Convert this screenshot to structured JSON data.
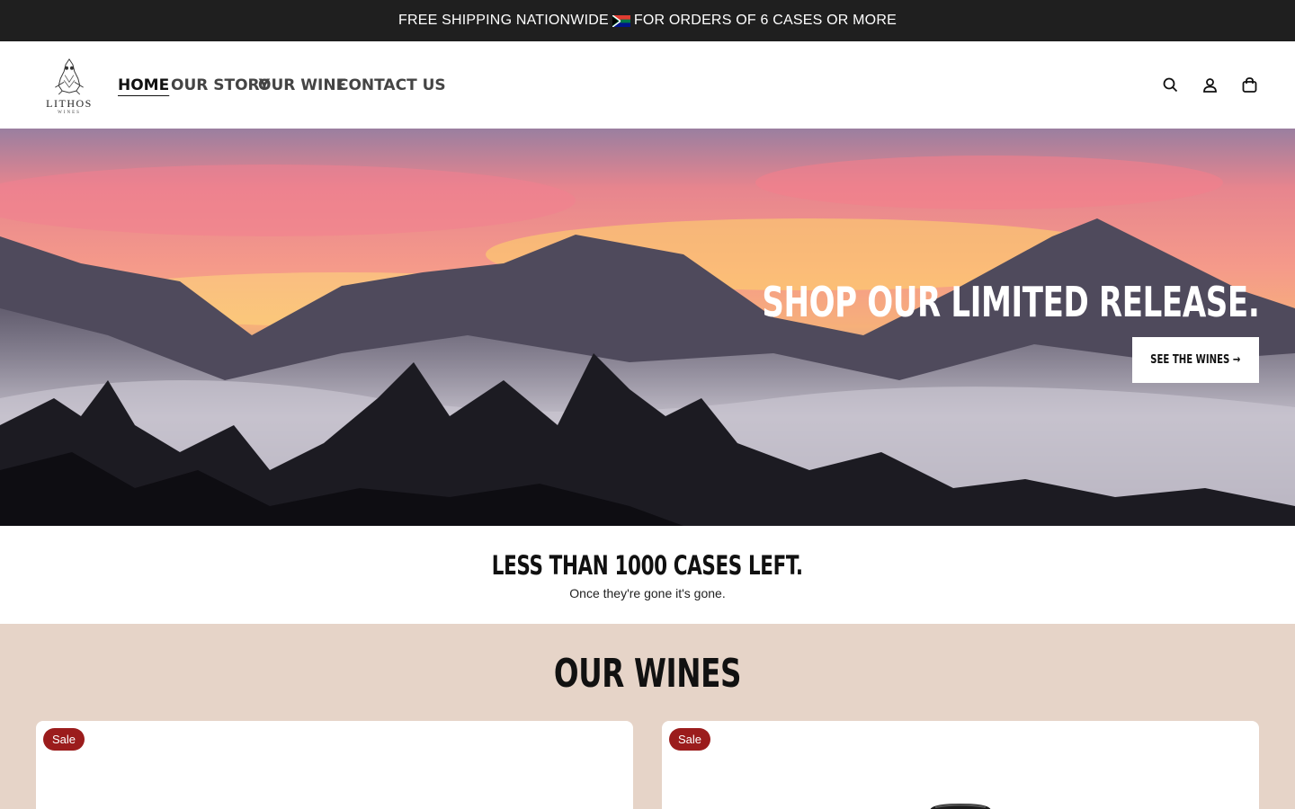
{
  "announcement": {
    "before_flag": "FREE SHIPPING NATIONWIDE",
    "after_flag": "FOR ORDERS OF 6 CASES OR MORE"
  },
  "logo": {
    "name": "LITHOS",
    "sub": "WINES"
  },
  "nav": {
    "items": [
      {
        "label": "HOME"
      },
      {
        "label": "OUR STORY"
      },
      {
        "label": "OUR WINE"
      },
      {
        "label": "CONTACT US"
      }
    ]
  },
  "icons": [
    "search-icon",
    "account-icon",
    "cart-icon"
  ],
  "hero": {
    "title": "SHOP OUR LIMITED RELEASE.",
    "button": "SEE THE WINES →"
  },
  "cases": {
    "title": "LESS THAN 1000 CASES LEFT.",
    "subtitle": "Once they're gone it's gone."
  },
  "wines": {
    "title": "OUR WINES",
    "cards": [
      {
        "badge": "Sale"
      },
      {
        "badge": "Sale"
      }
    ]
  },
  "colors": {
    "announcement_bg": "#1f1f1f",
    "wines_bg": "#e6d4c8",
    "sale_badge": "#9b1c1c"
  }
}
